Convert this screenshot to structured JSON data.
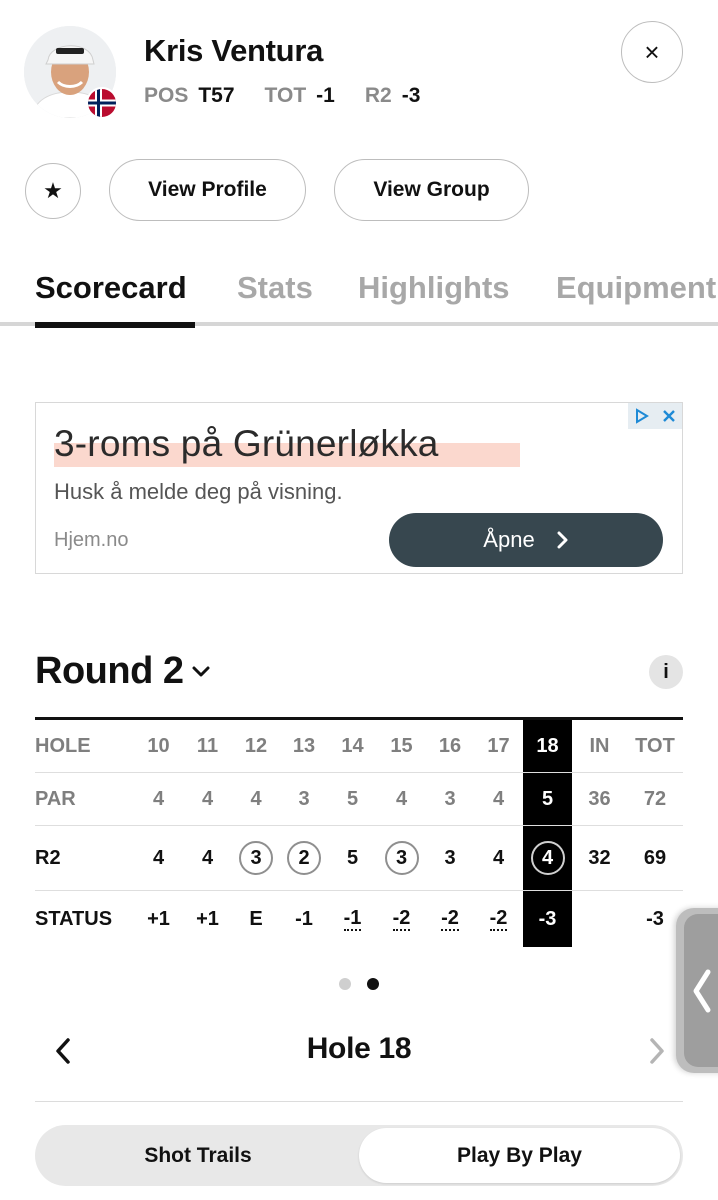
{
  "player": {
    "name": "Kris Ventura",
    "stats": [
      {
        "label": "POS",
        "value": "T57"
      },
      {
        "label": "TOT",
        "value": "-1"
      },
      {
        "label": "R2",
        "value": "-3"
      }
    ],
    "flag": "norway-flag-icon"
  },
  "actions": {
    "favorite_icon": "★",
    "view_profile": "View Profile",
    "view_group": "View Group",
    "close_icon": "×"
  },
  "tabs": [
    {
      "label": "Scorecard",
      "active": true
    },
    {
      "label": "Stats"
    },
    {
      "label": "Highlights"
    },
    {
      "label": "Equipment"
    }
  ],
  "ad": {
    "headline": "3-roms på Grünerløkka",
    "subtext": "Husk å melde deg på visning.",
    "domain": "Hjem.no",
    "cta": "Åpne"
  },
  "round": {
    "title": "Round 2",
    "info_icon": "i"
  },
  "scorecard": {
    "hole_label": "HOLE",
    "par_label": "PAR",
    "round_label": "R2",
    "status_label": "STATUS",
    "holes": [
      "10",
      "11",
      "12",
      "13",
      "14",
      "15",
      "16",
      "17",
      "18"
    ],
    "in_label": "IN",
    "tot_label": "TOT",
    "par": [
      "4",
      "4",
      "4",
      "3",
      "5",
      "4",
      "3",
      "4",
      "5"
    ],
    "par_in": "36",
    "par_tot": "72",
    "scores": [
      "4",
      "4",
      "3",
      "2",
      "5",
      "3",
      "3",
      "4",
      "4"
    ],
    "score_in": "32",
    "score_tot": "69",
    "status": [
      "+1",
      "+1",
      "E",
      "-1",
      "-1",
      "-2",
      "-2",
      "-2",
      "-3"
    ],
    "status_tot": "-3",
    "current_hole": "18"
  },
  "pager": {
    "pages": 2,
    "active": 2
  },
  "hole_nav": {
    "title": "Hole 18"
  },
  "segmented": {
    "left": "Shot Trails",
    "right": "Play By Play",
    "selected": "right"
  }
}
